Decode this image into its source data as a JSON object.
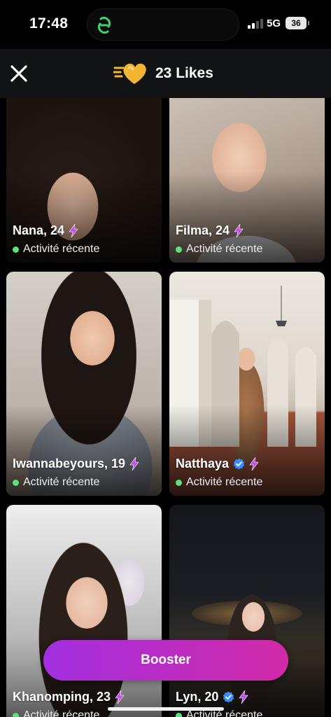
{
  "status_bar": {
    "time": "17:48",
    "network": "5G",
    "battery": "36"
  },
  "header": {
    "title": "23 Likes",
    "accent_color": "#f2b632"
  },
  "profiles": [
    {
      "name": "Nana, 24",
      "verified": false,
      "activity": "Activité récente"
    },
    {
      "name": "Filma, 24",
      "verified": false,
      "activity": "Activité récente"
    },
    {
      "name": "Iwannabeyours, 19",
      "verified": false,
      "activity": "Activité récente"
    },
    {
      "name": "Natthaya",
      "verified": true,
      "activity": "Activité récente"
    },
    {
      "name": "Khanomping, 23",
      "verified": false,
      "activity": "Activité récente"
    },
    {
      "name": "Lyn, 20",
      "verified": true,
      "activity": "Activité récente"
    }
  ],
  "booster": {
    "label": "Booster",
    "gradient": [
      "#a12fe0",
      "#d22aa6"
    ]
  }
}
